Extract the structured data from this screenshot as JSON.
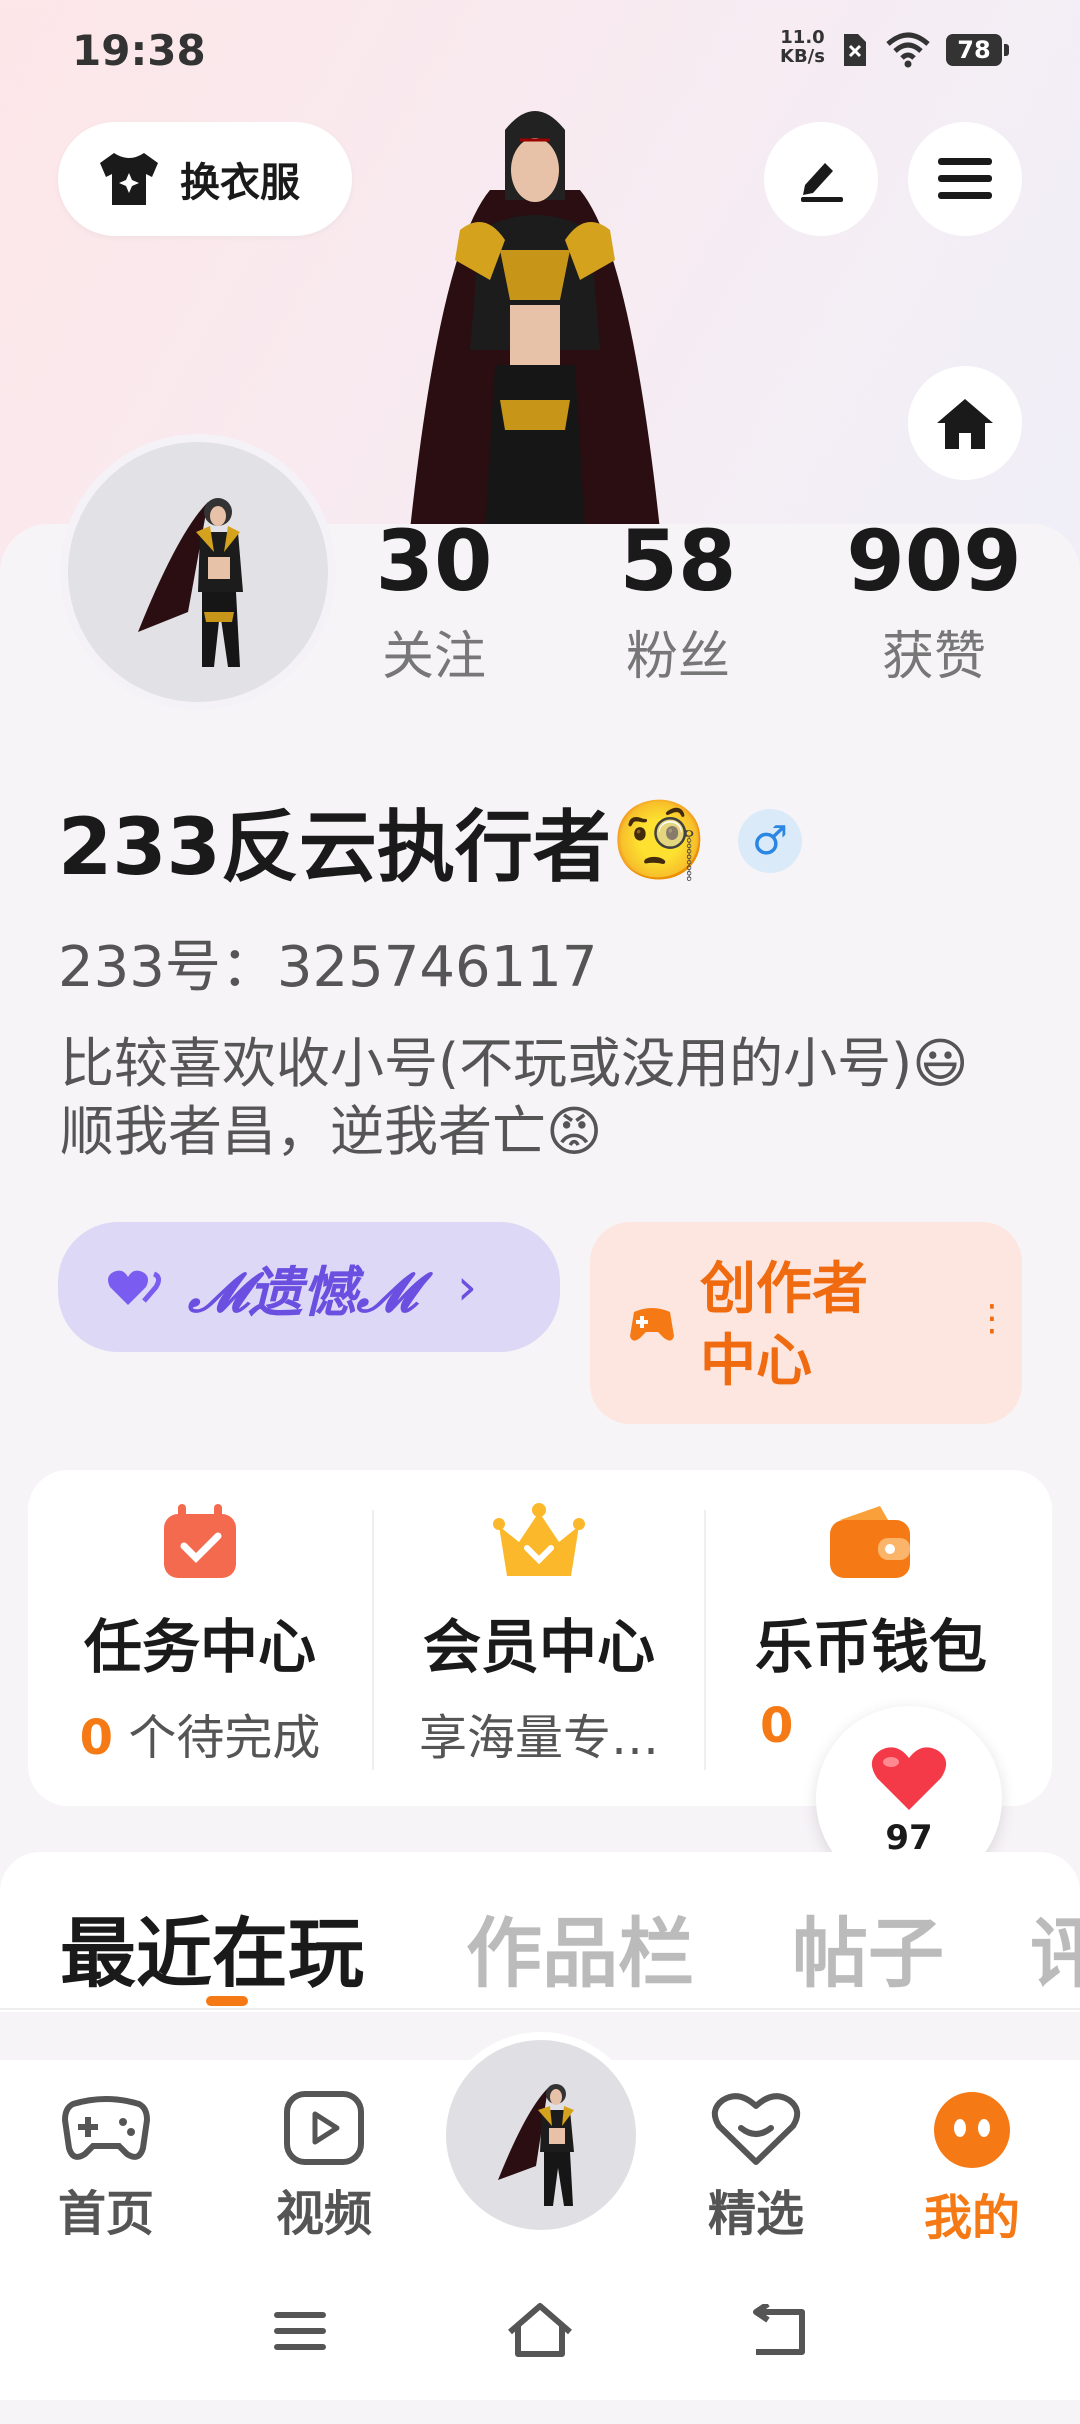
{
  "status": {
    "time": "19:38",
    "net_speed_value": "11.0",
    "net_speed_unit": "KB/s",
    "battery": "78"
  },
  "top": {
    "outfit_label": "换衣服"
  },
  "stats": [
    {
      "num": "30",
      "label": "关注"
    },
    {
      "num": "58",
      "label": "粉丝"
    },
    {
      "num": "909",
      "label": "获赞"
    }
  ],
  "profile": {
    "name": "233反云执行者",
    "name_emoji": "🧐",
    "gender_symbol": "♂",
    "uid_label": "233号：",
    "uid": "325746117",
    "bio": "比较喜欢收小号(不玩或没用的小号)😃顺我者昌，逆我者亡😡"
  },
  "tag": {
    "label": "𝓜遗憾𝓜",
    "arrow": "›"
  },
  "creator": {
    "label_line1": "创作者",
    "label_line2": "中心",
    "dots": "⋮"
  },
  "panel": [
    {
      "title": "任务中心",
      "sub_num": "0",
      "sub_text": " 个待完成"
    },
    {
      "title": "会员中心",
      "sub_num": "",
      "sub_text": "享海量专…"
    },
    {
      "title": "乐币钱包",
      "sub_num": "0",
      "sub_text": ""
    }
  ],
  "like": {
    "count": "97"
  },
  "tabs": [
    "最近在玩",
    "作品栏",
    "帖子",
    "评"
  ],
  "nav": [
    {
      "label": "首页"
    },
    {
      "label": "视频"
    },
    {
      "label": "精选"
    },
    {
      "label": "我的"
    }
  ],
  "colors": {
    "accent": "#f57a16",
    "tag_bg": "#ddd8f6",
    "creator_bg": "#fde6df"
  }
}
